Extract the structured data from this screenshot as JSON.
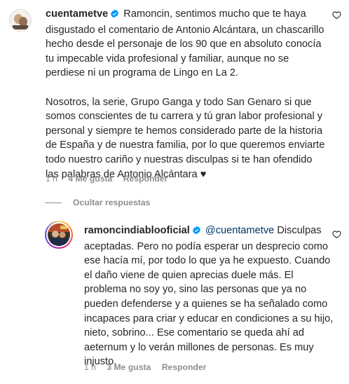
{
  "comments": [
    {
      "username": "cuentametve",
      "text": "Ramoncin, sentimos mucho que te haya disgustado el comentario de Antonio Alcántara, un chascarillo hecho desde el personaje de los 90 que en absoluto conocía tu impecable vida profesional y familiar, aunque no se perdiese ni un programa de Lingo en La 2.\n\nNosotros, la serie, Grupo Ganga y todo San Genaro si que somos conscientes de tu carrera y tú gran labor profesional y personal y siempre te hemos considerado parte de la historia de España y de nuestra familia, por lo que queremos enviarte todo nuestro cariño y nuestras disculpas si te han ofendido las palabras de Antonio Alcántara",
      "emoji": "♥",
      "time": "1 h",
      "likes": "4 Me gusta",
      "reply": "Responder"
    },
    {
      "username": "ramoncindiablooficial",
      "mention": "@cuentametve",
      "text": " Disculpas aceptadas. Pero no podía esperar un desprecio como ese hacía mí, por todo lo que ya he expuesto. Cuando el daño viene de quien aprecias duele más. El problema no soy yo, sino las personas que ya no pueden defenderse y a quienes se ha señalado como incapaces para criar y educar en condiciones a su hijo, nieto, sobrino... Ese comentario se queda ahí ad aeternum y lo verán millones de personas. Es muy injusto.",
      "time": "1 h",
      "likes": "3 Me gusta",
      "reply": "Responder"
    }
  ],
  "replies_toggle": "Ocultar respuestas",
  "icons": {
    "verified": "verified-badge-icon",
    "like": "heart-outline-icon"
  },
  "colors": {
    "verified": "#0095f6",
    "text": "#262626",
    "muted": "#8e8e8e",
    "mention": "#00376b"
  }
}
